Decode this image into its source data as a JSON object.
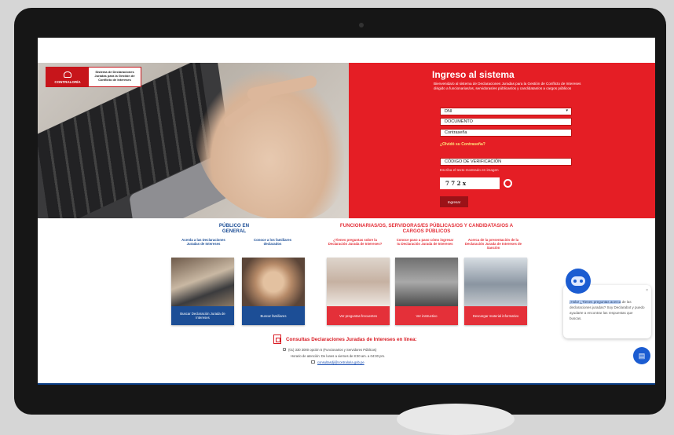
{
  "header": {
    "logo_org": "CONTRALORÍA",
    "logo_system": "Sistema de Declaraciones Juradas para la Gestión de Conflicto de Intereses"
  },
  "login": {
    "title": "Ingreso al sistema",
    "intro": "Bienvenida/o al sistema de Declaraciones Juradas para la Gestión de Conflicto de Intereses dirigido a funcionarias/os, servidoras/es públicas/os y candidatas/os a cargos públicos",
    "doc_type": "DNI",
    "document_placeholder": "DOCUMENTO",
    "password_placeholder": "Contraseña",
    "forgot": "¿Olvidó su Contraseña?",
    "verification_placeholder": "CÓDIGO DE VERIFICACIÓN",
    "captcha_hint": "Escriba el texto mostrado en imagen",
    "captcha_text": "7 7 2 x",
    "submit": "Ingresar"
  },
  "public_section": {
    "heading": "PÚBLICO EN GENERAL",
    "sub1": "Acerda a las Declaraciones Juradas de Intereses",
    "sub2": "Conoce a los familiares declarados",
    "card1": "Buscar Declaración Jurada de Intereses",
    "card2": "Buscar familiares"
  },
  "officials_section": {
    "heading": "FUNCIONARIAS/OS, SERVIDORAS/ES PÚBLICAS/OS Y CANDIDATAS/OS A CARGOS PÚBLICOS",
    "sub1": "¿Tienes preguntas sobre la Declaración Jurada de Intereses?",
    "sub2": "Conoce paso a paso cómo ingresar tu Declaración Jurada de Intereses",
    "sub3": "Acerca de la presentación de la Declaración Jurada de Intereses de Sanción",
    "card1": "Ver preguntas frecuentes",
    "card2": "Ver instructivo",
    "card3": "Descargar material informativo"
  },
  "consult": {
    "title": "Consultas Declaraciones Juradas de Intereses en línea:",
    "phone": "(01) 330 3000 opción 5 (Funcionarios y Servidores Públicos)",
    "hours": "Horario de atención: De lunes a viernes de 8:30 am. a 04:30 pm.",
    "email": "consultasdji@contraloria.gob.pe"
  },
  "chat": {
    "greeting_hl": "¡Hola! ¿Tienes preguntas acerca",
    "greeting_rest": "de las declaraciones juradas? Soy Declarabot y puedo ayudarte a encontrar las respuestas que buscas."
  },
  "colors": {
    "accent_red": "#e51e25",
    "navy": "#1c4e96",
    "chat_blue": "#1b5cd1"
  }
}
